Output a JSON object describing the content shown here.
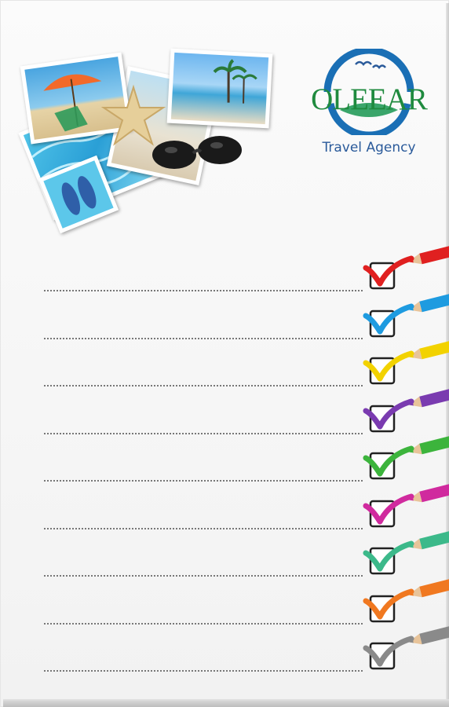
{
  "brand": {
    "name": "OLEEAR",
    "tagline": "Travel Agency",
    "name_color": "#1f8a3e",
    "tagline_color": "#2a5a9a",
    "ring_color": "#1a6fb5"
  },
  "collage": {
    "photos": [
      "beach-umbrella-photo",
      "swimming-pool-photo",
      "resort-palms-photo",
      "flip-flops-photo"
    ],
    "decor": [
      "starfish",
      "sunglasses"
    ]
  },
  "checklist": {
    "rows": [
      {
        "color": "#e02020"
      },
      {
        "color": "#1e9be0"
      },
      {
        "color": "#f2d200"
      },
      {
        "color": "#7a3bb0"
      },
      {
        "color": "#3cb43c"
      },
      {
        "color": "#d02a9e"
      },
      {
        "color": "#3cb98a"
      },
      {
        "color": "#f07820"
      },
      {
        "color": "#8a8a8a"
      }
    ]
  }
}
